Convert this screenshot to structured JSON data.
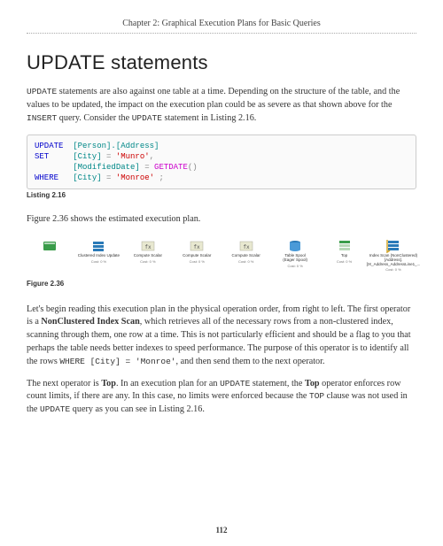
{
  "chapter_header": "Chapter 2: Graphical Execution Plans for Basic Queries",
  "section_title": "UPDATE statements",
  "paragraph1_a": "UPDATE",
  "paragraph1_b": " statements are also against one table at a time. Depending on the structure of the table, and the values to be updated, the impact on the execution plan could be as severe as that shown above for the ",
  "paragraph1_c": "INSERT",
  "paragraph1_d": " query. Consider the ",
  "paragraph1_e": "UPDATE",
  "paragraph1_f": " statement in Listing 2.16.",
  "code": {
    "l1_kw": "UPDATE",
    "l1_rest": "  [Person].[Address]",
    "l2_kw": "SET",
    "l2_col1": "     [City] ",
    "l2_eq1": "=",
    "l2_val1": " 'Munro'",
    "l2_comma": ",",
    "l3_col": "        [ModifiedDate] ",
    "l3_eq": "=",
    "l3_fn": " GETDATE",
    "l3_par": "()",
    "l4_kw": "WHERE",
    "l4_col": "   [City] ",
    "l4_eq": "=",
    "l4_val": " 'Monroe'",
    "l4_semi": " ;"
  },
  "listing_caption": "Listing 2.16",
  "paragraph2": "Figure 2.36 shows the estimated execution plan.",
  "figure_ops": [
    {
      "label": "",
      "cost": "",
      "icon": "tsql"
    },
    {
      "label": "Clustered Index Update",
      "cost": "Cost: 0 %",
      "icon": "update"
    },
    {
      "label": "Compute Scalar",
      "cost": "Cost: 0 %",
      "icon": "compute"
    },
    {
      "label": "Compute Scalar",
      "cost": "Cost: 0 %",
      "icon": "compute"
    },
    {
      "label": "Compute Scalar",
      "cost": "Cost: 0 %",
      "icon": "compute"
    },
    {
      "label": "Table Spool\n(Eager Spool)",
      "cost": "Cost: 0 %",
      "icon": "spool"
    },
    {
      "label": "Top",
      "cost": "Cost: 0 %",
      "icon": "top"
    },
    {
      "label": "Index Scan (NonClustered)\n[Address].[IX_Address_AddressLine1_...",
      "cost": "Cost: 0 %",
      "icon": "scan"
    }
  ],
  "figure_caption": "Figure 2.36",
  "paragraph3_a": "Let's begin reading this execution plan in the physical operation order, from right to left. The first operator is a ",
  "paragraph3_b": "NonClustered Index Scan",
  "paragraph3_c": ", which retrieves all of the necessary rows from a non-clustered index, scanning through them, one row at a time. This is not particularly efficient and should be a flag to you that perhaps the table needs better indexes to speed performance. The purpose of this operator is to identify all the rows ",
  "paragraph3_d": "WHERE [City] = 'Monroe'",
  "paragraph3_e": ", and then send them to the next operator.",
  "paragraph4_a": "The next operator is ",
  "paragraph4_b": "Top",
  "paragraph4_c": ". In an execution plan for an ",
  "paragraph4_d": "UPDATE",
  "paragraph4_e": " statement, the ",
  "paragraph4_f": "Top",
  "paragraph4_g": " operator enforces row count limits, if there are any. In this case, no limits were enforced because the ",
  "paragraph4_h": "TOP",
  "paragraph4_i": " clause was not used in the ",
  "paragraph4_j": "UPDATE",
  "paragraph4_k": " query as you can see in Listing 2.16.",
  "page_number": "112"
}
